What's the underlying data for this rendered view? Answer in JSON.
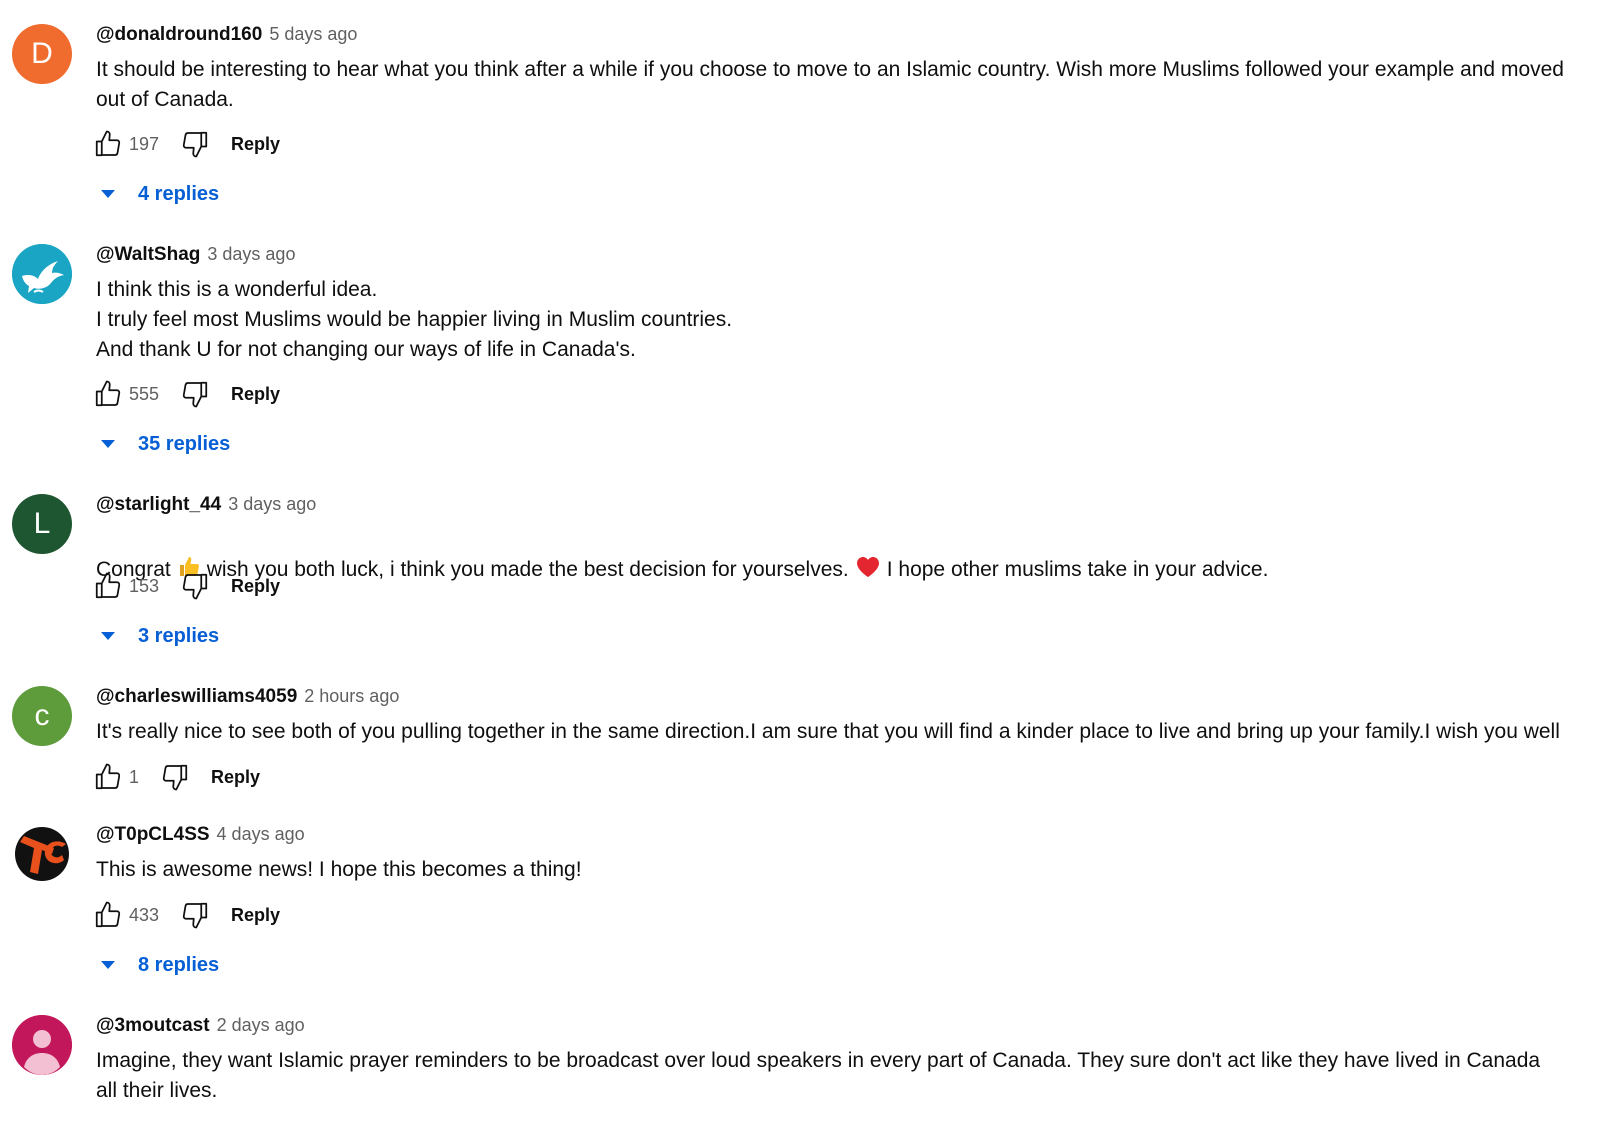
{
  "colors": {
    "link_blue": "#065fd4",
    "meta_gray": "#606060",
    "text": "#0f0f0f"
  },
  "comments": [
    {
      "author": "@donaldround160",
      "time": "5 days ago",
      "text": "It should be interesting to hear what you think after a while if you choose to move to an Islamic country. Wish more Muslims followed your example and moved out of Canada.",
      "likes": "197",
      "reply_label": "Reply",
      "replies": "4 replies",
      "avatar": {
        "type": "letter",
        "letter": "D",
        "color": "#ef6c2e"
      }
    },
    {
      "author": "@WaltShag",
      "time": "3 days ago",
      "text": "I think this is a wonderful idea.\nI truly feel most Muslims would be happier living in Muslim countries.\nAnd thank U for not changing our ways of life in Canada's.",
      "likes": "555",
      "reply_label": "Reply",
      "replies": "35 replies",
      "avatar": {
        "type": "image",
        "icon": "dove-icon",
        "color": "#1aa5c4"
      }
    },
    {
      "author": "@starlight_44",
      "time": "3 days ago",
      "text_before": "Congrat",
      "text_middle": "wish you both luck, i think you made the best decision for yourselves.",
      "text_after": "I hope other muslims take in your advice.",
      "emoji_1": "thumbs-up-emoji",
      "emoji_2": "red-heart-emoji",
      "likes": "153",
      "reply_label": "Reply",
      "replies": "3 replies",
      "avatar": {
        "type": "letter",
        "letter": "L",
        "color": "#1e5631"
      }
    },
    {
      "author": "@charleswilliams4059",
      "time": "2 hours ago",
      "text": "It's really nice to see both of you pulling together in the same direction.I am sure that you will find a kinder place to live and bring up your family.I wish you well",
      "likes": "1",
      "reply_label": "Reply",
      "avatar": {
        "type": "letter",
        "letter": "c",
        "color": "#5e9b3a"
      }
    },
    {
      "author": "@T0pCL4SS",
      "time": "4 days ago",
      "text": "This is awesome news! I hope this becomes a thing!",
      "likes": "433",
      "reply_label": "Reply",
      "replies": "8 replies",
      "avatar": {
        "type": "image",
        "icon": "tc-logo-icon",
        "color": "#111111"
      }
    },
    {
      "author": "@3moutcast",
      "time": "2 days ago",
      "text": "Imagine, they want Islamic prayer reminders to be broadcast over loud speakers in every part of Canada. They sure don't act like they have lived in Canada all their lives.",
      "avatar": {
        "type": "image",
        "icon": "default-person-icon",
        "color": "#c2185b"
      }
    }
  ]
}
